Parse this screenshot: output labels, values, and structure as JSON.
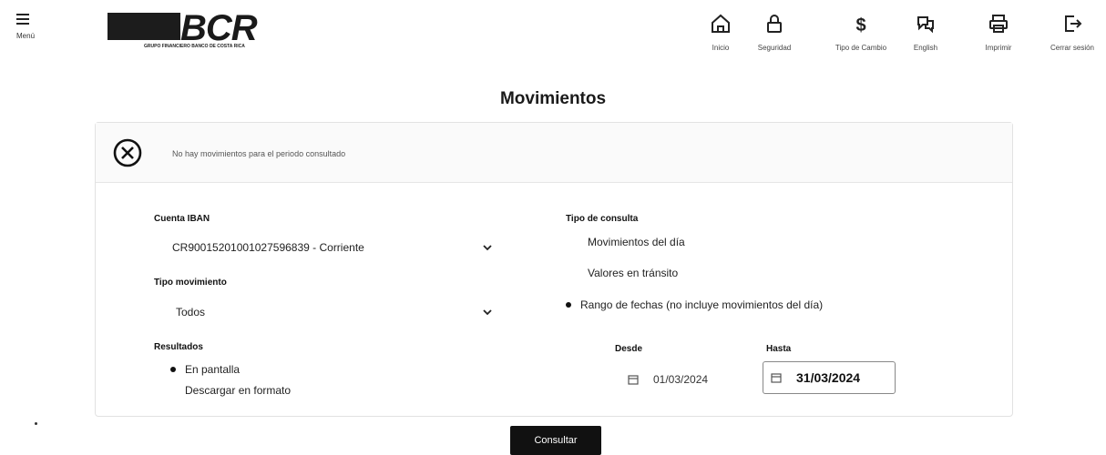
{
  "header": {
    "menu_label": "Menú",
    "logo_text": "BCR",
    "logo_sub": "GRUPO FINANCIERO BANCO DE COSTA RICA",
    "nav": [
      {
        "icon": "home-icon",
        "label": "Inicio"
      },
      {
        "icon": "lock-icon",
        "label": "Seguridad"
      },
      {
        "icon": "dollar-icon",
        "label": "Tipo de Cambio"
      },
      {
        "icon": "translate-icon",
        "label": "English"
      },
      {
        "icon": "printer-icon",
        "label": "Imprimir"
      },
      {
        "icon": "logout-icon",
        "label": "Cerrar sesión"
      }
    ]
  },
  "page": {
    "title": "Movimientos"
  },
  "alert": {
    "message": "No hay movimientos para el periodo consultado"
  },
  "form": {
    "account_label": "Cuenta IBAN",
    "account_value": "CR90015201001027596839 - Corriente",
    "type_label": "Tipo movimiento",
    "type_value": "Todos",
    "results_label": "Resultados",
    "results_options": [
      "En pantalla",
      "Descargar en formato"
    ],
    "results_selected": "En pantalla",
    "query_label": "Tipo de consulta",
    "query_options": [
      "Movimientos del día",
      "Valores en tránsito",
      "Rango de fechas (no incluye movimientos del día)"
    ],
    "query_selected": "Rango de fechas (no incluye movimientos del día)",
    "from_label": "Desde",
    "from_value": "01/03/2024",
    "to_label": "Hasta",
    "to_value": "31/03/2024"
  },
  "submit_label": "Consultar"
}
